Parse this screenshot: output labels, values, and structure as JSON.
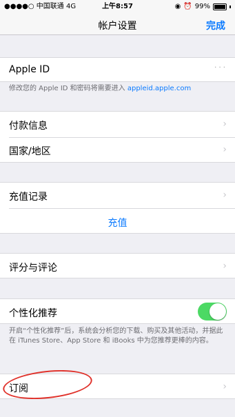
{
  "status": {
    "carrier": "●●●●○ 中国联通 4G",
    "time": "上午8:57",
    "battery_percent": "99%"
  },
  "nav": {
    "title": "帐户设置",
    "done": "完成"
  },
  "apple_id": {
    "label": "Apple ID",
    "value": "· · ·",
    "note_prefix": "修改您的 Apple ID 和密码将需要进入 ",
    "note_link": "appleid.apple.com"
  },
  "payment": {
    "label": "付款信息"
  },
  "region": {
    "label": "国家/地区"
  },
  "recharge_history": {
    "label": "充值记录"
  },
  "recharge": {
    "label": "充值"
  },
  "ratings": {
    "label": "评分与评论"
  },
  "personalized": {
    "label": "个性化推荐",
    "enabled": true,
    "note": "开启“个性化推荐”后，系统会分析您的下载、购买及其他活动，并据此在 iTunes Store、App Store 和 iBooks 中为您推荐更棒的内容。"
  },
  "subscriptions": {
    "label": "订阅"
  },
  "icons": [
    "chevron-right-icon",
    "battery-icon",
    "alarm-icon",
    "orientation-lock-icon"
  ],
  "colors": {
    "accent": "#0a7aff",
    "toggle_on": "#4cd964",
    "annotation": "#e0322b"
  }
}
